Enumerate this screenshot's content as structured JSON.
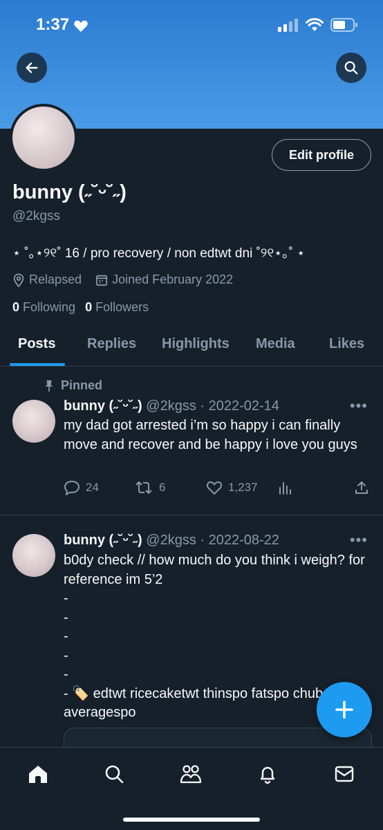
{
  "status_bar": {
    "time": "1:37"
  },
  "profile": {
    "display_name": "bunny (˶˘ᵕ˘˶)",
    "handle": "@2kgss",
    "bio": "⋆ ˚｡⋆୨୧˚ 16 / pro recovery / non edtwt dni ˚୨୧⋆｡˚ ⋆",
    "location": "Relapsed",
    "joined": "Joined February 2022",
    "following_count": "0",
    "following_label": "Following",
    "followers_count": "0",
    "followers_label": "Followers",
    "edit_profile_label": "Edit profile"
  },
  "tabs": [
    {
      "label": "Posts",
      "active": true
    },
    {
      "label": "Replies"
    },
    {
      "label": "Highlights"
    },
    {
      "label": "Media"
    },
    {
      "label": "Likes"
    }
  ],
  "tweets": [
    {
      "pinned_label": "Pinned",
      "name": "bunny (˶˘ᵕ˘˶)",
      "meta": " @2kgss · 2022-02-14",
      "text": "my dad got arrested i’m so happy i can finally move and recover and be happy i love you guys",
      "replies": "24",
      "retweets": "6",
      "likes": "1,237"
    },
    {
      "name": "bunny (˶˘ᵕ˘˶)",
      "meta": " @2kgss · 2022-08-22",
      "text": "b0dy check // how much do you think i weigh? for reference im 5’2\n-\n-\n-\n-\n-\n- 🏷️ edtwt ricecaketwt thinspo fatspo chubspo averagespo"
    }
  ],
  "colors": {
    "accent": "#1d9bf0",
    "background": "#15202b",
    "secondary_text": "#8b98a5",
    "banner": "#4a9be6"
  }
}
